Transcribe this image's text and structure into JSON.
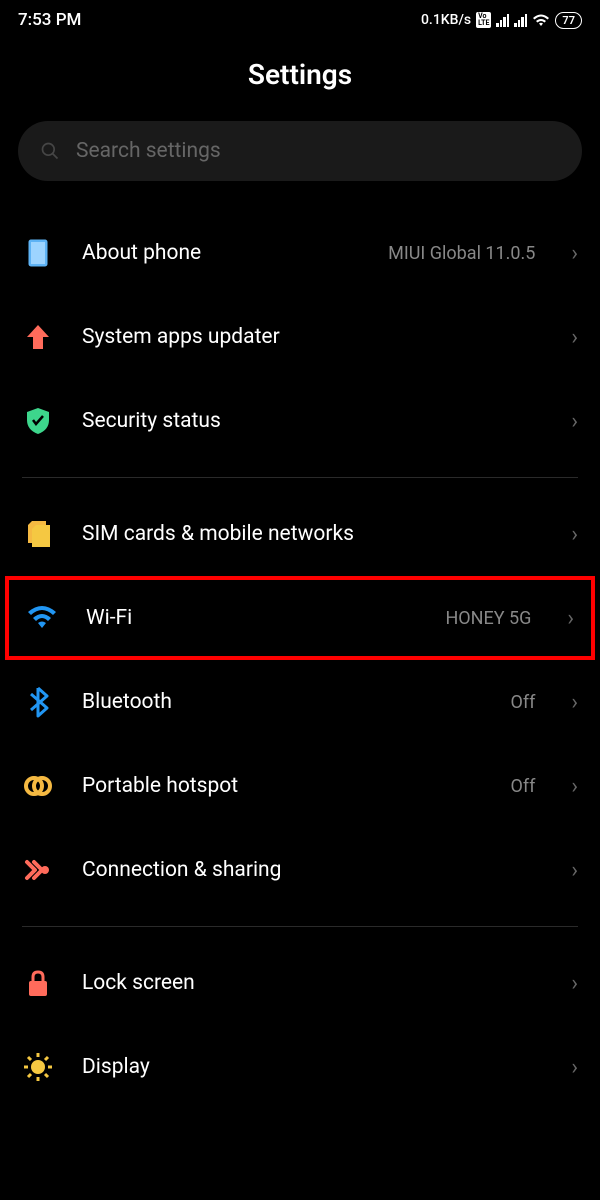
{
  "statusBar": {
    "time": "7:53 PM",
    "dataRate": "0.1KB/s",
    "battery": "77"
  },
  "header": {
    "title": "Settings"
  },
  "search": {
    "placeholder": "Search settings"
  },
  "sections": [
    {
      "items": [
        {
          "icon": "phone",
          "label": "About phone",
          "value": "MIUI Global 11.0.5"
        },
        {
          "icon": "arrow-up",
          "label": "System apps updater",
          "value": ""
        },
        {
          "icon": "shield",
          "label": "Security status",
          "value": ""
        }
      ]
    },
    {
      "items": [
        {
          "icon": "sim",
          "label": "SIM cards & mobile networks",
          "value": ""
        },
        {
          "icon": "wifi",
          "label": "Wi-Fi",
          "value": "HONEY 5G",
          "highlighted": true
        },
        {
          "icon": "bluetooth",
          "label": "Bluetooth",
          "value": "Off"
        },
        {
          "icon": "hotspot",
          "label": "Portable hotspot",
          "value": "Off"
        },
        {
          "icon": "connection",
          "label": "Connection & sharing",
          "value": ""
        }
      ]
    },
    {
      "items": [
        {
          "icon": "lock",
          "label": "Lock screen",
          "value": ""
        },
        {
          "icon": "display",
          "label": "Display",
          "value": ""
        }
      ]
    }
  ]
}
